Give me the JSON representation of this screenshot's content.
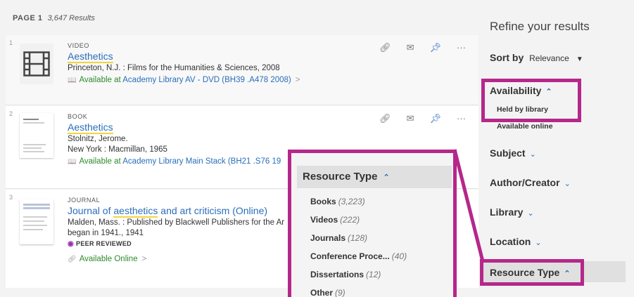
{
  "header": {
    "page_label": "PAGE 1",
    "result_count": "3,647 Results"
  },
  "results": [
    {
      "num": "1",
      "type": "VIDEO",
      "title": "Aesthetics",
      "line1": "Princeton, N.J. : Films for the Humanities & Sciences, 2008",
      "avail_prefix": "Available at",
      "avail_location": "Academy Library  AV - DVD (BH39 .A478 2008)",
      "chevron": ">"
    },
    {
      "num": "2",
      "type": "BOOK",
      "title": "Aesthetics",
      "line1": "Stolnitz, Jerome.",
      "line2": "New York : Macmillan, 1965",
      "avail_prefix": "Available at",
      "avail_location": "Academy Library  Main Stack (BH21 .S76 19"
    },
    {
      "num": "3",
      "type": "JOURNAL",
      "title_pre": "Journal of ",
      "title_hl": "aesthetics",
      "title_post": " and art criticism (Online)",
      "line1": "Malden, Mass. : Published by Blackwell Publishers for the Ar",
      "line2": "began in 1941., 1941",
      "peer": "PEER REVIEWED",
      "avail_online": "Available Online",
      "chevron": ">"
    }
  ],
  "actions": {
    "link_icon": "link-icon",
    "email_icon": "email-icon",
    "pin_icon": "pin-icon",
    "more_icon": "more-icon",
    "more_glyph": "···"
  },
  "sidebar": {
    "title": "Refine your results",
    "sort_label": "Sort by",
    "sort_value": "Relevance",
    "availability": "Availability",
    "availability_options": [
      "Held by library",
      "Available online"
    ],
    "subject": "Subject",
    "author": "Author/Creator",
    "library": "Library",
    "location": "Location",
    "resource_type": "Resource Type"
  },
  "popup": {
    "title": "Resource Type",
    "items": [
      {
        "label": "Books",
        "count": "(3,223)"
      },
      {
        "label": "Videos",
        "count": "(222)"
      },
      {
        "label": "Journals",
        "count": "(128)"
      },
      {
        "label": "Conference Proce...",
        "count": "(40)"
      },
      {
        "label": "Dissertations",
        "count": "(12)"
      },
      {
        "label": "Other",
        "count": "(9)"
      }
    ]
  },
  "colors": {
    "highlight": "#b5278b",
    "link": "#2a6ebb",
    "available": "#2d8a2d",
    "search_hl": "#f2d53c"
  }
}
